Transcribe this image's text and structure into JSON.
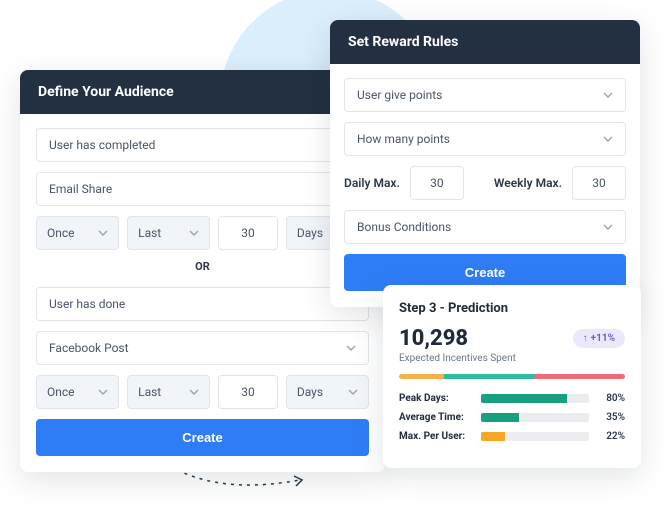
{
  "audience": {
    "title": "Define Your Audience",
    "select1": "User has completed",
    "select2": "Email Share",
    "row1": {
      "freq": "Once",
      "range": "Last",
      "num": "30",
      "unit": "Days"
    },
    "or": "OR",
    "select3": "User has done",
    "select4": "Facebook Post",
    "row2": {
      "freq": "Once",
      "range": "Last",
      "num": "30",
      "unit": "Days"
    },
    "create": "Create"
  },
  "reward": {
    "title": "Set Reward Rules",
    "select1": "User give points",
    "select2": "How many points",
    "dailyLabel": "Daily Max.",
    "dailyVal": "30",
    "weeklyLabel": "Weekly Max.",
    "weeklyVal": "30",
    "select3": "Bonus Conditions",
    "create": "Create"
  },
  "pred": {
    "title": "Step 3 - Prediction",
    "value": "10,298",
    "sub": "Expected Incentives Spent",
    "badge": "+11%",
    "metrics": [
      {
        "label": "Peak Days:",
        "pct": 80,
        "val": "80%",
        "color": "#17a07f"
      },
      {
        "label": "Average Time:",
        "pct": 35,
        "val": "35%",
        "color": "#17a07f"
      },
      {
        "label": "Max. Per User:",
        "pct": 22,
        "val": "22%",
        "color": "#f5a623"
      }
    ]
  }
}
